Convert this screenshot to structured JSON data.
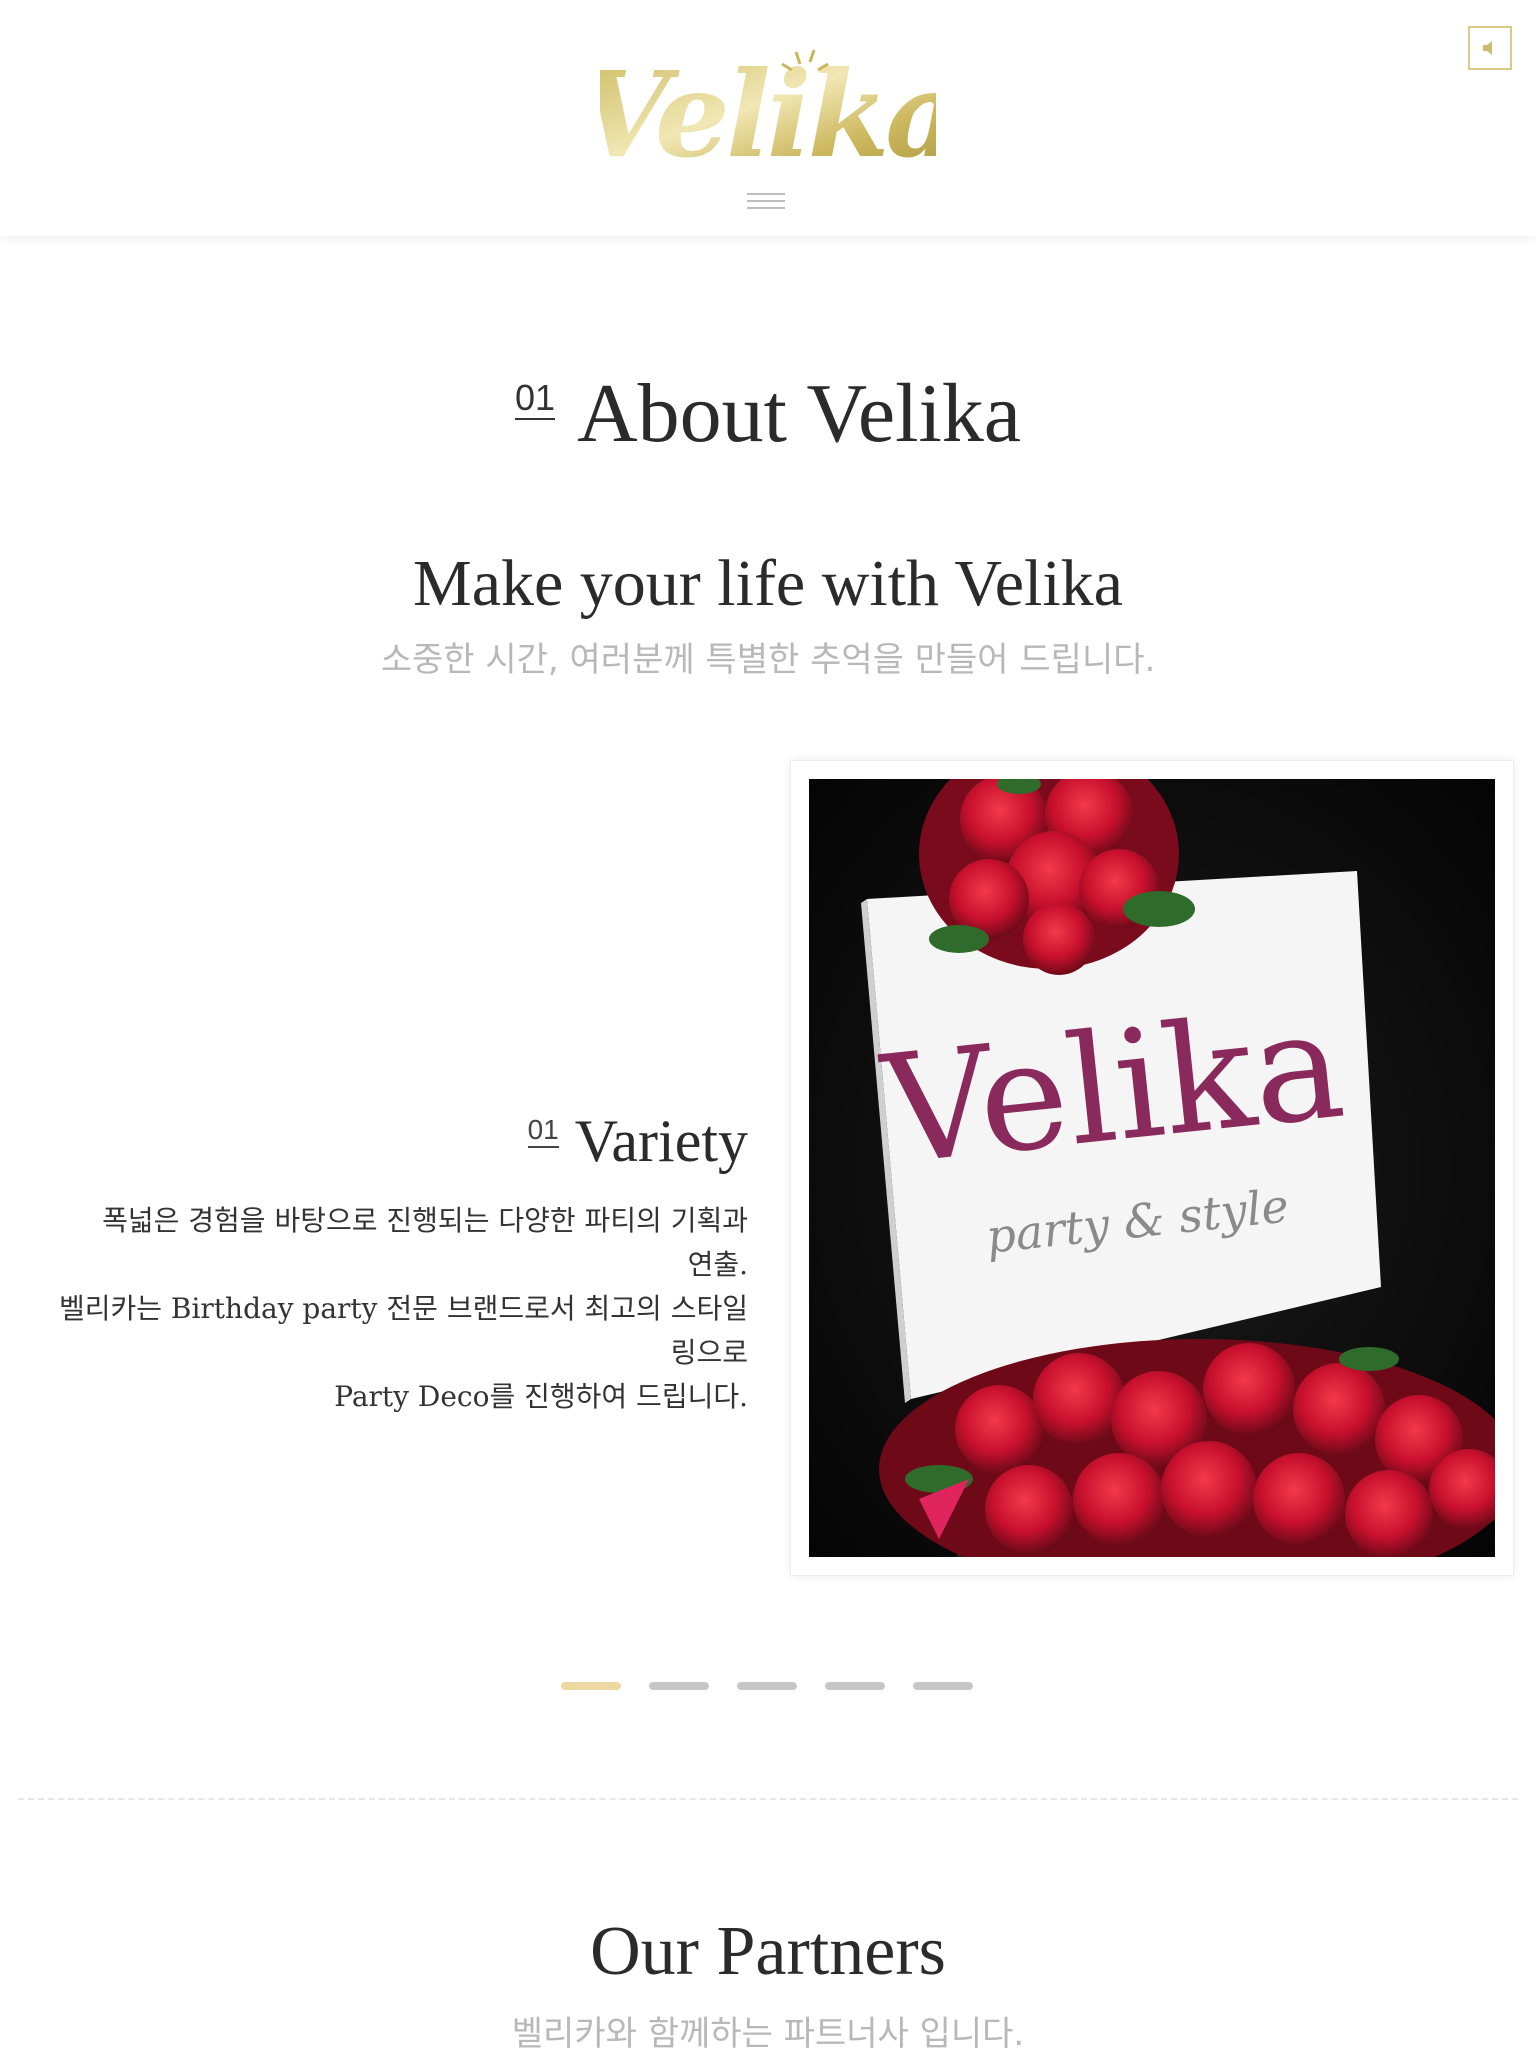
{
  "header": {
    "logo_text": "Velika",
    "menu_icon": "hamburger-menu-icon",
    "sound_icon": "speaker-icon"
  },
  "about": {
    "number": "01",
    "title": "About Velika",
    "tagline": "Make your life with Velika",
    "tagline_sub": "소중한 시간, 여러분께 특별한 추억을 만들어 드립니다."
  },
  "slides": {
    "active_index": 0,
    "count": 5,
    "current": {
      "number": "01",
      "title": "Variety",
      "lines": [
        "폭넓은 경험을 바탕으로 진행되는 다양한 파티의 기획과",
        "연출.",
        "벨리카는 Birthday party 전문 브랜드로서 최고의 스타일",
        "링으로",
        "Party Deco를 진행하여 드립니다."
      ],
      "photo": {
        "sign_brand": "Velika",
        "sign_sub": "party & style"
      }
    }
  },
  "partners": {
    "title": "Our Partners",
    "subtitle": "벨리카와 함께하는 파트너사 입니다."
  },
  "colors": {
    "gold": "#d9cc8a",
    "pager_active": "#ecd8a0",
    "pager_inactive": "#c6c6c6",
    "sign_purple": "#8a2a5c",
    "flower_red": "#c8102e"
  }
}
